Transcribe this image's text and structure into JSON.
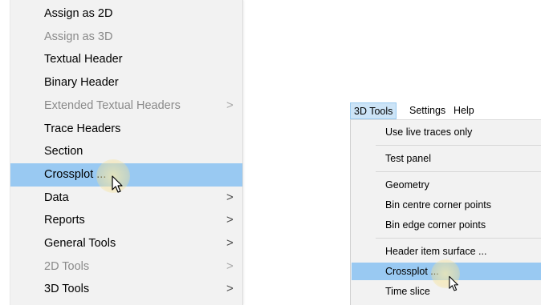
{
  "left_menu": {
    "items": [
      {
        "label": "Assign as 2D",
        "enabled": true,
        "submenu": false
      },
      {
        "label": "Assign as 3D",
        "enabled": false,
        "submenu": false
      },
      {
        "label": "Textual Header",
        "enabled": true,
        "submenu": false
      },
      {
        "label": "Binary Header",
        "enabled": true,
        "submenu": false
      },
      {
        "label": "Extended Textual Headers",
        "enabled": false,
        "submenu": true
      },
      {
        "label": "Trace Headers",
        "enabled": true,
        "submenu": false
      },
      {
        "label": "Section",
        "enabled": true,
        "submenu": false
      },
      {
        "label": "Crossplot ...",
        "enabled": true,
        "submenu": false,
        "highlighted": true
      },
      {
        "label": "Data",
        "enabled": true,
        "submenu": true
      },
      {
        "label": "Reports",
        "enabled": true,
        "submenu": true
      },
      {
        "label": "General Tools",
        "enabled": true,
        "submenu": true
      },
      {
        "label": "2D Tools",
        "enabled": false,
        "submenu": true
      },
      {
        "label": "3D Tools",
        "enabled": true,
        "submenu": true
      }
    ],
    "submenu_arrow": ">"
  },
  "menubar": {
    "items": [
      "3D Tools",
      "Settings",
      "Help"
    ],
    "active": "3D Tools"
  },
  "dropdown": {
    "items": [
      "Use live traces only",
      "Test panel",
      "Geometry",
      "Bin centre corner points",
      "Bin edge corner points",
      "Header item surface ...",
      "Crossplot ...",
      "Time slice"
    ],
    "highlighted": "Crossplot ..."
  },
  "colors": {
    "highlight": "#99c9f2",
    "menu_bg": "#f2f2f2",
    "disabled_text": "#8a8a8a",
    "menubar_active": "#cce4f7"
  },
  "icons": [
    "mouse-pointer-icon",
    "submenu-arrow-icon"
  ]
}
